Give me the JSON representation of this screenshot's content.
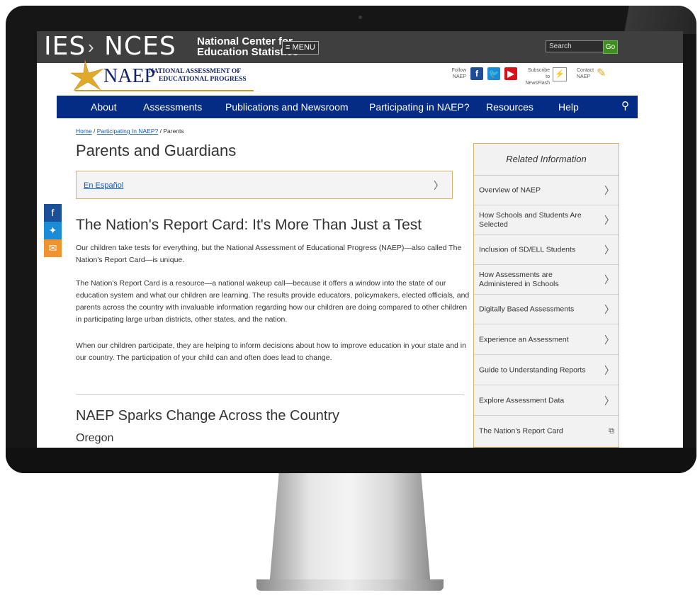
{
  "ies": {
    "brand": "IES",
    "sep": "›",
    "nces": "NCES",
    "name_line1": "National Center for",
    "name_line2": "Education Statistics",
    "menu": "≡ MENU",
    "search_placeholder": "Search",
    "go": "Go"
  },
  "naep": {
    "word": "NAEP",
    "sub1": "NATIONAL ASSESSMENT OF",
    "sub2": "EDUCATIONAL PROGRESS",
    "follow_1": "Follow",
    "follow_2": "NAEP",
    "subscribe_1": "Subscribe to",
    "subscribe_2": "NewsFlash",
    "contact_1": "Contact",
    "contact_2": "NAEP"
  },
  "nav": {
    "items": [
      "About",
      "Assessments",
      "Publications and Newsroom",
      "Participating in NAEP?",
      "Resources",
      "Help"
    ]
  },
  "breadcrumb": {
    "home": "Home",
    "sep1": " / ",
    "participating": "Participating In NAEP?",
    "sep2": " / ",
    "current": "Parents"
  },
  "page_title": "Parents and Guardians",
  "espanol": "En Español",
  "section1": {
    "heading": "The Nation's Report Card: It's More Than Just a Test",
    "p1": "Our children take tests for everything, but the National Assessment of Educational Progress (NAEP)—also called The Nation's Report Card—is unique.",
    "p2": "The Nation's Report Card is a resource—a national wakeup call—because it offers a window into the state of our education system and what our children are learning. The results provide educators, policymakers, elected officials, and parents across the country with invaluable information regarding how our children are doing compared to other children in participating large urban districts, other states, and the nation.",
    "p3": "When our children participate, they are helping to inform decisions about how to improve education in your state and in our country. The participation of your child can and often does lead to change."
  },
  "section2": {
    "heading": "NAEP Sparks Change Across the Country",
    "sub": "Oregon"
  },
  "related": {
    "title": "Related Information",
    "items": [
      "Overview of NAEP",
      "How Schools and Students Are Selected",
      "Inclusion of SD/ELL Students",
      "How Assessments are Administered in Schools",
      "Digitally Based Assessments",
      "Experience an Assessment",
      "Guide to Understanding Reports",
      "Explore Assessment Data",
      "The Nation's Report Card"
    ]
  },
  "colors": {
    "nav_bg": "#052c84",
    "ies_bar": "#3f3f3f",
    "accent_gold": "#d7b46a",
    "link": "#1659b4"
  }
}
